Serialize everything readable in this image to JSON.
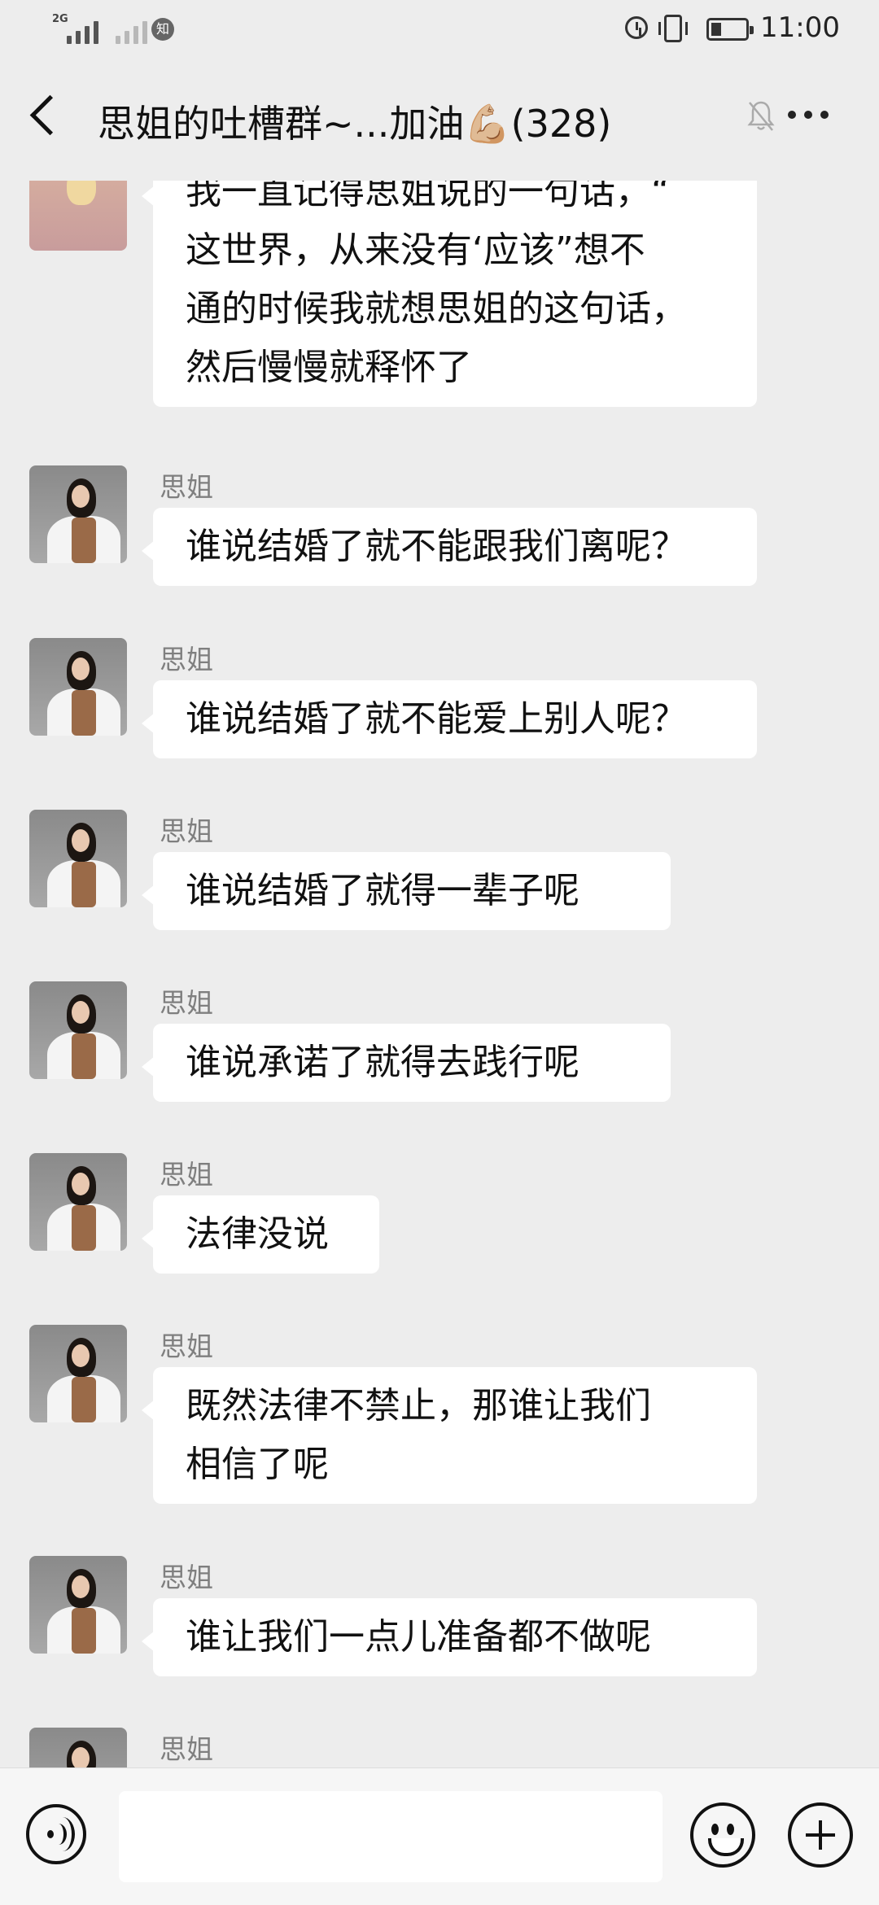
{
  "status_bar": {
    "network_label": "2G",
    "app_badge": "知",
    "time": "11:00"
  },
  "header": {
    "title": "思姐的吐槽群~...加油💪🏼(328)"
  },
  "messages": [
    {
      "sender": "",
      "lines": [
        "我一直记得思姐说的一句话，“",
        "这世界，从来没有‘应该”想不",
        "通的时候我就想思姐的这句话，",
        "然后慢慢就释怀了"
      ]
    },
    {
      "sender": "思姐",
      "lines": [
        "谁说结婚了就不能跟我们离呢？"
      ]
    },
    {
      "sender": "思姐",
      "lines": [
        "谁说结婚了就不能爱上别人呢？"
      ]
    },
    {
      "sender": "思姐",
      "lines": [
        "谁说结婚了就得一辈子呢"
      ]
    },
    {
      "sender": "思姐",
      "lines": [
        "谁说承诺了就得去践行呢"
      ]
    },
    {
      "sender": "思姐",
      "lines": [
        "法律没说"
      ]
    },
    {
      "sender": "思姐",
      "lines": [
        "既然法律不禁止，那谁让我们",
        "相信了呢"
      ]
    },
    {
      "sender": "思姐",
      "lines": [
        "谁让我们一点儿准备都不做呢"
      ]
    },
    {
      "sender": "思姐",
      "lines": []
    }
  ],
  "input_bar": {
    "message_value": ""
  }
}
